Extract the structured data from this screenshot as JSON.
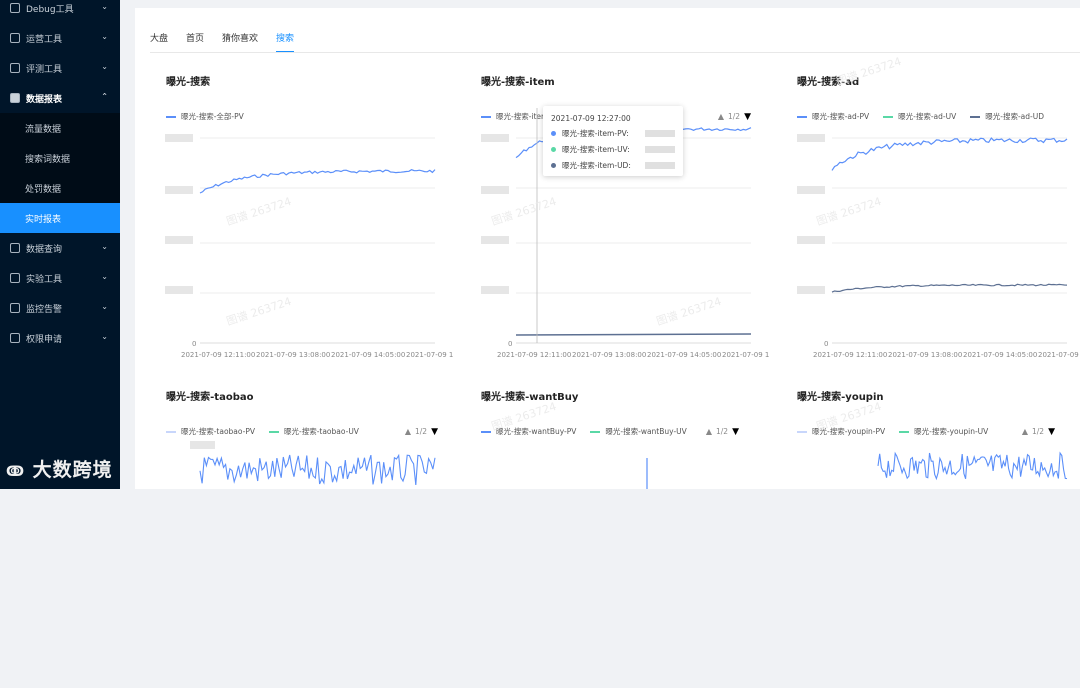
{
  "sidebar": {
    "items": [
      {
        "label": "Debug工具",
        "icon": "bug-icon"
      },
      {
        "label": "运营工具",
        "icon": "tool-icon"
      },
      {
        "label": "评测工具",
        "icon": "file-icon"
      },
      {
        "label": "数据报表",
        "icon": "chart-icon"
      }
    ],
    "subitems": [
      "流量数据",
      "搜索词数据",
      "处罚数据",
      "实时报表"
    ],
    "items2": [
      {
        "label": "数据查询",
        "icon": "query-icon"
      },
      {
        "label": "实验工具",
        "icon": "flask-icon"
      },
      {
        "label": "监控告警",
        "icon": "monitor-icon"
      },
      {
        "label": "权限申请",
        "icon": "lock-icon"
      }
    ],
    "watermark_logo": "大数跨境"
  },
  "tabs": [
    "大盘",
    "首页",
    "猜你喜欢",
    "搜索"
  ],
  "charts": [
    {
      "title": "曝光-搜索",
      "legend": [
        "曝光-搜索-全部-PV"
      ]
    },
    {
      "title": "曝光-搜索-item",
      "legend": [
        "曝光-搜索-item-PV"
      ],
      "pager": "1/2"
    },
    {
      "title": "曝光-搜索-ad",
      "legend": [
        "曝光-搜索-ad-PV",
        "曝光-搜索-ad-UV",
        "曝光-搜索-ad-UD"
      ]
    },
    {
      "title": "曝光-搜索-taobao",
      "legend": [
        "曝光-搜索-taobao-PV",
        "曝光-搜索-taobao-UV"
      ],
      "pager": "1/2"
    },
    {
      "title": "曝光-搜索-wantBuy",
      "legend": [
        "曝光-搜索-wantBuy-PV",
        "曝光-搜索-wantBuy-UV"
      ],
      "pager": "1/2"
    },
    {
      "title": "曝光-搜索-youpin",
      "legend": [
        "曝光-搜索-youpin-PV",
        "曝光-搜索-youpin-UV"
      ],
      "pager": "1/2"
    }
  ],
  "xticks": [
    "2021-07-09 12:11:00",
    "2021-07-09 13:08:00",
    "2021-07-09 14:05:00",
    "2021-07-09 1"
  ],
  "y_zero": "0",
  "tooltip": {
    "time": "2021-07-09 12:27:00",
    "rows": [
      "曝光-搜索-item-PV:",
      "曝光-搜索-item-UV:",
      "曝光-搜索-item-UD:"
    ]
  },
  "colors": {
    "pv": "#5b8ff9",
    "uv": "#5ad8a6",
    "ud": "#5d7092",
    "active": "#1890ff",
    "sidebar": "#001529"
  },
  "watermark_text": "图谱 263724"
}
